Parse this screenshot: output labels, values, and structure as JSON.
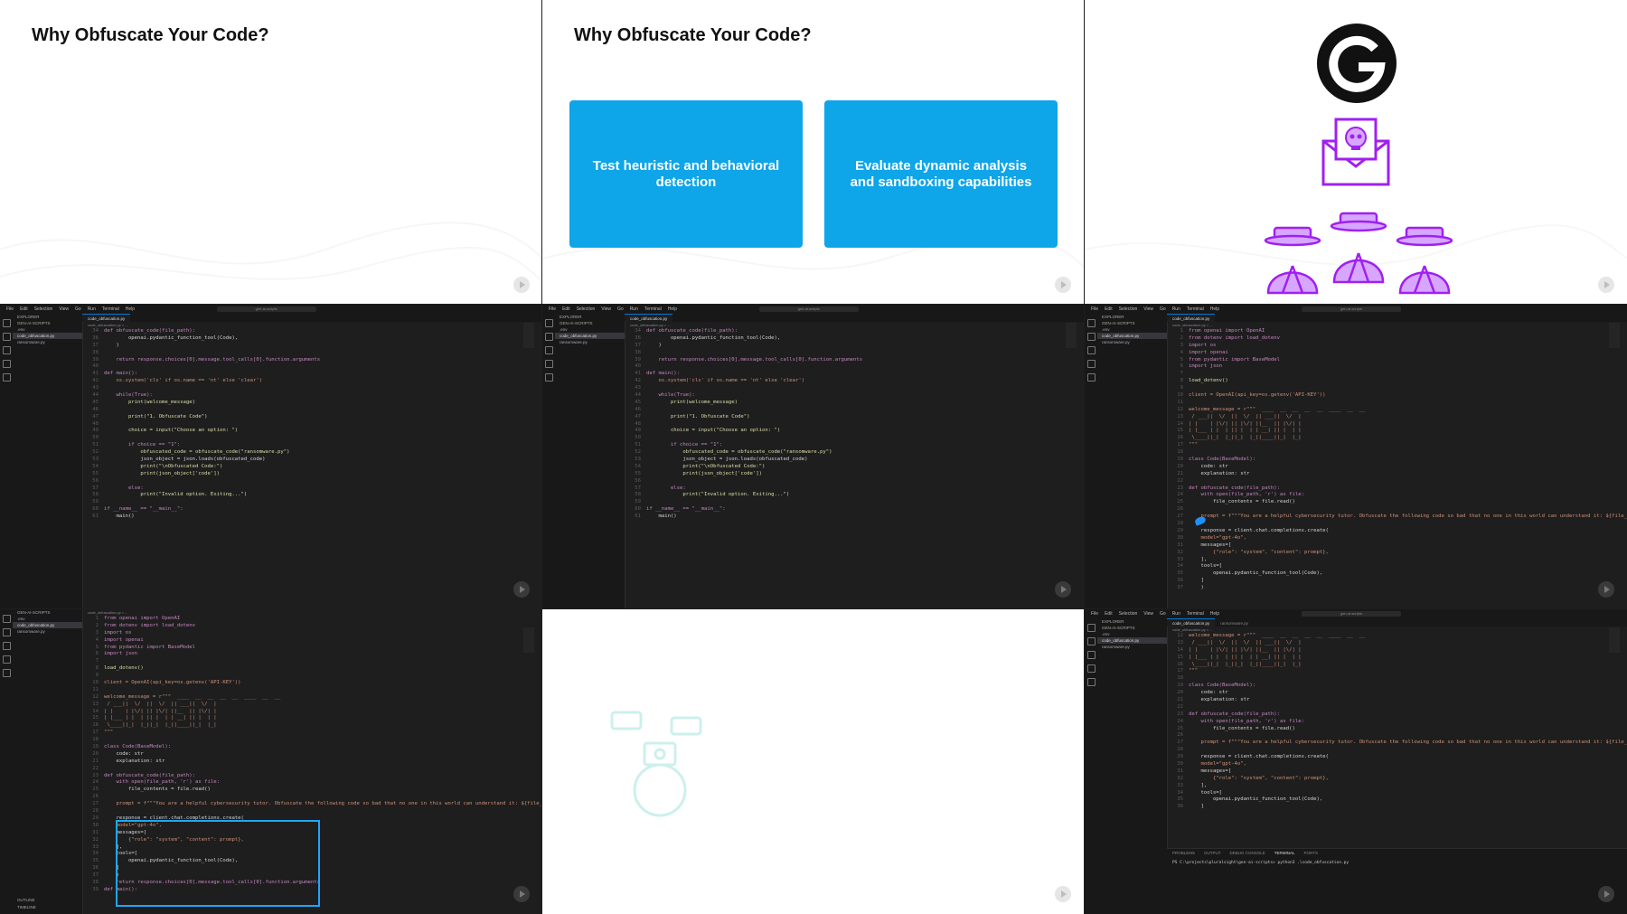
{
  "slides": [
    {
      "title": "Why Obfuscate Your Code?"
    },
    {
      "title": "Why Obfuscate Your Code?",
      "cards": [
        "Test heuristic and behavioral detection",
        "Evaluate dynamic analysis and sandboxing capabilities"
      ]
    },
    {
      "icons": [
        "g-logo-icon",
        "skull-envelope-icon",
        "hacker-group-icon"
      ]
    }
  ],
  "ide": {
    "menu": [
      "File",
      "Edit",
      "Selection",
      "View",
      "Go",
      "Run",
      "Terminal",
      "Help"
    ],
    "search": "gen-ai-scripts",
    "explorer": {
      "header": "EXPLORER",
      "root": "GEN-AI-SCRIPTS",
      "items": [
        ".env",
        "code_obfuscation.py",
        "ransomware.py"
      ]
    },
    "tab": "code_obfuscation.py",
    "tab2": "ransomware.py",
    "breadcrumb": "code_obfuscation.py > ...",
    "code_main": [
      [
        "34",
        "def obfuscate_code(file_path):"
      ],
      [
        "36",
        "        openai.pydantic_function_tool(Code),"
      ],
      [
        "37",
        "    )"
      ],
      [
        "38",
        ""
      ],
      [
        "39",
        "    return response.choices[0].message.tool_calls[0].function.arguments"
      ],
      [
        "40",
        ""
      ],
      [
        "41",
        "def main():"
      ],
      [
        "42",
        "    os.system('cls' if os.name == 'nt' else 'clear')"
      ],
      [
        "43",
        ""
      ],
      [
        "44",
        "    while(True):"
      ],
      [
        "45",
        "        print(welcome_message)"
      ],
      [
        "46",
        ""
      ],
      [
        "47",
        "        print(\"1. Obfuscate Code\")"
      ],
      [
        "48",
        ""
      ],
      [
        "49",
        "        choice = input(\"Choose an option: \")"
      ],
      [
        "50",
        ""
      ],
      [
        "51",
        "        if choice == \"1\":"
      ],
      [
        "52",
        "            obfuscated_code = obfuscate_code(\"ransomware.py\")"
      ],
      [
        "53",
        "            json_object = json.loads(obfuscated_code)"
      ],
      [
        "54",
        "            print(\"\\nObfuscated Code:\")"
      ],
      [
        "55",
        "            print(json_object['code'])"
      ],
      [
        "56",
        ""
      ],
      [
        "57",
        "        else:"
      ],
      [
        "58",
        "            print(\"Invalid option. Exiting...\")"
      ],
      [
        "59",
        ""
      ],
      [
        "60",
        "if __name__ == \"__main__\":"
      ],
      [
        "61",
        "    main()"
      ]
    ],
    "code_top": [
      [
        "1",
        "from openai import OpenAI"
      ],
      [
        "2",
        "from dotenv import load_dotenv"
      ],
      [
        "3",
        "import os"
      ],
      [
        "4",
        "import openai"
      ],
      [
        "5",
        "from pydantic import BaseModel"
      ],
      [
        "6",
        "import json"
      ],
      [
        "7",
        ""
      ],
      [
        "8",
        "load_dotenv()"
      ],
      [
        "9",
        ""
      ],
      [
        "10",
        "client = OpenAI(api_key=os.getenv('API-KEY'))"
      ],
      [
        "11",
        ""
      ],
      [
        "12",
        "welcome_message = r\"\"\"  ____  __  __  __  __  ____  __  __"
      ],
      [
        "13",
        " / ___||  \\/  ||  \\/  || ___||  \\/  |"
      ],
      [
        "14",
        "| |    | |\\/| || |\\/| ||__  || |\\/| |"
      ],
      [
        "15",
        "| |___ | |  | || |  | | __| || |  | |"
      ],
      [
        "16",
        " \\____||_|  |_||_|  |_||____||_|  |_|"
      ],
      [
        "17",
        "\"\"\""
      ],
      [
        "18",
        ""
      ],
      [
        "19",
        "class Code(BaseModel):"
      ],
      [
        "20",
        "    code: str"
      ],
      [
        "21",
        "    explanation: str"
      ],
      [
        "22",
        ""
      ],
      [
        "23",
        "def obfuscate_code(file_path):"
      ],
      [
        "24",
        "    with open(file_path, 'r') as file:"
      ],
      [
        "25",
        "        file_contents = file.read()"
      ],
      [
        "26",
        ""
      ],
      [
        "27",
        "    prompt = f\"\"\"You are a helpful cybersecurity tutor. Obfuscate the following code so bad that no one in this world can understand it: ${file_co"
      ],
      [
        "28",
        ""
      ],
      [
        "29",
        "    response = client.chat.completions.create("
      ],
      [
        "30",
        "    model=\"gpt-4o\","
      ],
      [
        "31",
        "    messages=["
      ],
      [
        "32",
        "        {\"role\": \"system\", \"content\": prompt},"
      ],
      [
        "33",
        "    ],"
      ],
      [
        "34",
        "    tools=["
      ],
      [
        "35",
        "        openai.pydantic_function_tool(Code),"
      ],
      [
        "36",
        "    ]"
      ],
      [
        "37",
        "    )"
      ],
      [
        "38",
        "    return response.choices[0].message.tool_calls[0].function.arguments"
      ],
      [
        "39",
        "def main():"
      ]
    ],
    "code_bottom_right": [
      [
        "12",
        "welcome_message = r\"\"\"  ____  __  __  __  __  ____  __  __"
      ],
      [
        "13",
        " / ___||  \\/  ||  \\/  || ___||  \\/  |"
      ],
      [
        "14",
        "| |    | |\\/| || |\\/| ||__  || |\\/| |"
      ],
      [
        "15",
        "| |___ | |  | || |  | | __| || |  | |"
      ],
      [
        "16",
        " \\____||_|  |_||_|  |_||____||_|  |_|"
      ],
      [
        "17",
        "\"\"\""
      ],
      [
        "18",
        ""
      ],
      [
        "19",
        "class Code(BaseModel):"
      ],
      [
        "20",
        "    code: str"
      ],
      [
        "21",
        "    explanation: str"
      ],
      [
        "22",
        ""
      ],
      [
        "23",
        "def obfuscate_code(file_path):"
      ],
      [
        "24",
        "    with open(file_path, 'r') as file:"
      ],
      [
        "25",
        "        file_contents = file.read()"
      ],
      [
        "26",
        ""
      ],
      [
        "27",
        "    prompt = f\"\"\"You are a helpful cybersecurity tutor. Obfuscate the following code so bad that no one in this world can understand it: ${file_co"
      ],
      [
        "28",
        ""
      ],
      [
        "29",
        "    response = client.chat.completions.create("
      ],
      [
        "30",
        "    model=\"gpt-4o\","
      ],
      [
        "31",
        "    messages=["
      ],
      [
        "32",
        "        {\"role\": \"system\", \"content\": prompt},"
      ],
      [
        "33",
        "    ],"
      ],
      [
        "34",
        "    tools=["
      ],
      [
        "35",
        "        openai.pydantic_function_tool(Code),"
      ],
      [
        "36",
        "    ]"
      ],
      [
        "37",
        "    )"
      ],
      [
        "38",
        "    return response.choices[0].message.tool_calls[0].function.arguments"
      ]
    ],
    "terminal": {
      "tabs": [
        "PROBLEMS",
        "OUTPUT",
        "DEBUG CONSOLE",
        "TERMINAL",
        "PORTS"
      ],
      "prompt": "PS C:\\projects\\pluralsight\\gen-ai-scripts> python3 .\\code_obfuscation.py"
    },
    "outline": [
      "OUTLINE",
      "TIMELINE"
    ]
  },
  "colors": {
    "card": "#0ea5e9",
    "icon_purple": "#a020f0",
    "highlight": "#1ea7ff",
    "editor_bg": "#1e1e1e"
  }
}
